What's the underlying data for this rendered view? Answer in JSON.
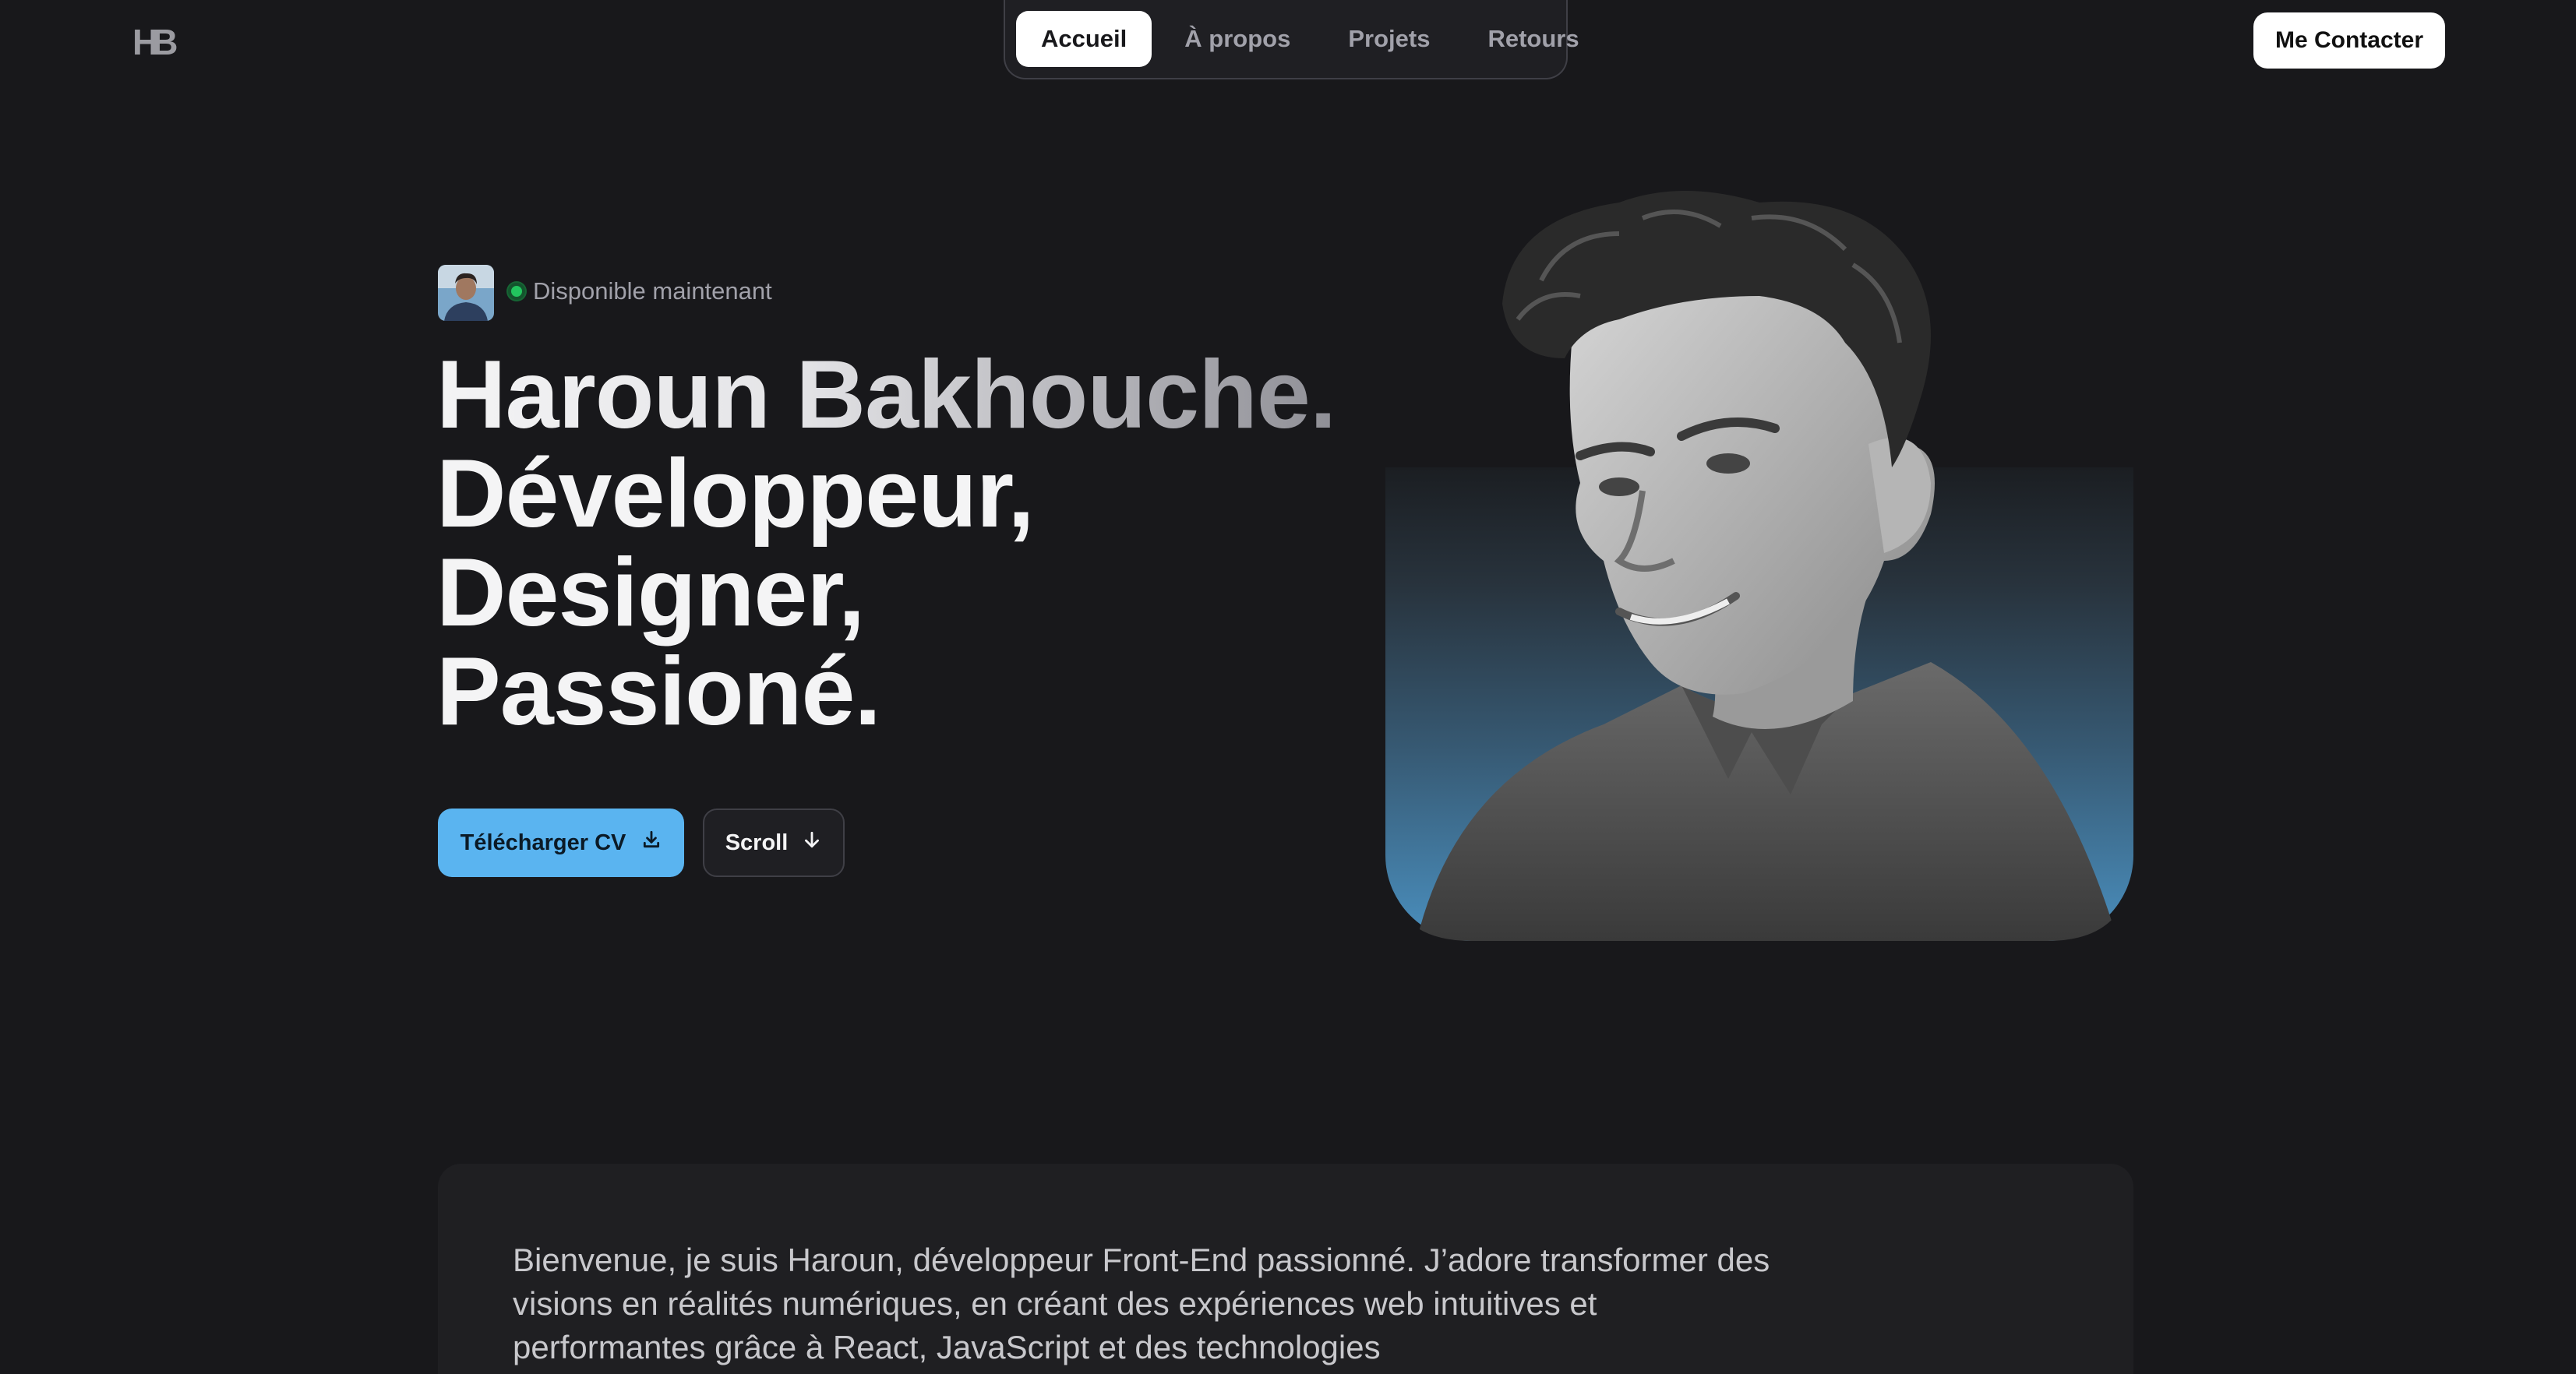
{
  "header": {
    "logo": "HB",
    "nav": [
      {
        "label": "Accueil",
        "active": true
      },
      {
        "label": "À propos",
        "active": false
      },
      {
        "label": "Projets",
        "active": false
      },
      {
        "label": "Retours",
        "active": false
      }
    ],
    "contact_label": "Me Contacter"
  },
  "hero": {
    "status": "Disponible maintenant",
    "headline": [
      "Haroun Bakhouche.",
      "Développeur,",
      "Designer,",
      "Passioné."
    ],
    "cv_button": "Télécharger CV",
    "scroll_button": "Scroll"
  },
  "about": {
    "text": "Bienvenue, je suis Haroun, développeur Front-End passionné. J’adore transformer des visions en réalités numériques, en créant des expériences web intuitives et performantes grâce à React, JavaScript et des technologies"
  },
  "colors": {
    "background": "#18181b",
    "accent": "#5ab4f0",
    "status_green": "#22c55e"
  },
  "icons": {
    "download": "download-icon",
    "scroll": "arrow-down-icon"
  }
}
